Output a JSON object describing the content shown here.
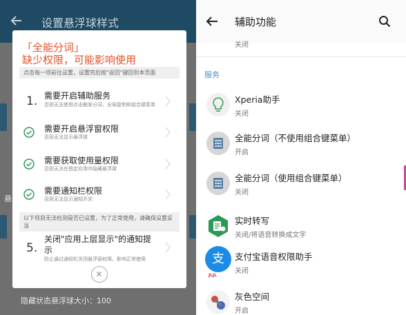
{
  "left": {
    "appbar_title": "设置悬浮球样式",
    "dialog": {
      "title_line1": "「全能分词」",
      "title_line2": "缺少权限，可能影响使用",
      "hint1": "点击每一项前往设置，设置完后按\"返回\"键回到本页面",
      "items": [
        {
          "marker": "1.",
          "title": "需要开启辅助服务",
          "desc": "否则无法使用点击触发分词、全局复制和组合键菜单"
        },
        {
          "marker": "check",
          "title": "需要开启悬浮窗权限",
          "desc": "否则无法显示悬浮球"
        },
        {
          "marker": "check",
          "title": "需要获取使用量权限",
          "desc": "否则无法在指定应用中隐藏悬浮球"
        },
        {
          "marker": "check",
          "title": "需要通知栏权限",
          "desc": "否则无法显示通知开关"
        }
      ],
      "hint2": "以下项目无法检测是否已设置，为了正常使用，请确保设置妥当",
      "item5": {
        "marker": "5.",
        "title_line1": "关闭\"应用上层显示\"的通知提",
        "title_line2": "示",
        "desc": "防止通过通知栏关闭悬浮窗权限，影响正常使用"
      }
    },
    "bottom_text": "隐藏状态悬浮球大小：100",
    "side_char": "悬"
  },
  "right": {
    "title": "辅助功能",
    "top_status": "关闭",
    "section_label": "服务",
    "items": [
      {
        "name": "Xperia助手",
        "status": "关闭",
        "icon": "bulb-icon"
      },
      {
        "name": "全能分词（不使用组合键菜单）",
        "status": "开启",
        "icon": "tagger-icon"
      },
      {
        "name": "全能分词（使用组合键菜单）",
        "status": "关闭",
        "icon": "tagger-icon"
      },
      {
        "name": "实时转写",
        "status": "关闭/将语音转换成文字",
        "icon": "transcribe-icon"
      },
      {
        "name": "支付宝语音权限助手",
        "status": "关闭",
        "icon": "alipay-icon",
        "badge": "JLJL"
      },
      {
        "name": "灰色空间",
        "status": "开启",
        "icon": "grayspace-icon"
      }
    ]
  },
  "colors": {
    "left_appbar": "#1f4a63",
    "dim_overlay": "#6f6f6f",
    "dialog_title": "#e0522a",
    "check_green": "#2e9a5a",
    "section_blue": "#4d8fc7",
    "alipay_blue": "#1a8ce8",
    "transcribe_green": "#2a9a55"
  }
}
